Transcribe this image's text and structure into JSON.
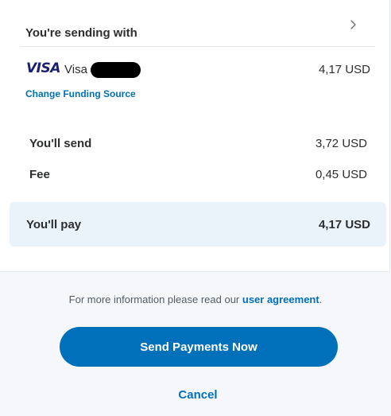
{
  "funding": {
    "header": "You're sending with",
    "chevron_icon": "chevron-right-icon",
    "brand_logo": "VISA",
    "card_name": "Visa",
    "amount": "4,17 USD",
    "change_link": "Change Funding Source"
  },
  "summary": {
    "send_label": "You'll send",
    "send_amount": "3,72 USD",
    "fee_label": "Fee",
    "fee_amount": "0,45 USD",
    "pay_label": "You'll pay",
    "pay_amount": "4,17 USD"
  },
  "footer": {
    "info_prefix": "For more information please read our ",
    "info_link": "user agreement",
    "info_suffix": ".",
    "send_button": "Send Payments Now",
    "cancel_link": "Cancel"
  },
  "colors": {
    "primary": "#0070ba",
    "visa_blue": "#1a1f71",
    "pay_box_bg": "#eaf3f9",
    "page_bg": "#f5f7fa"
  }
}
